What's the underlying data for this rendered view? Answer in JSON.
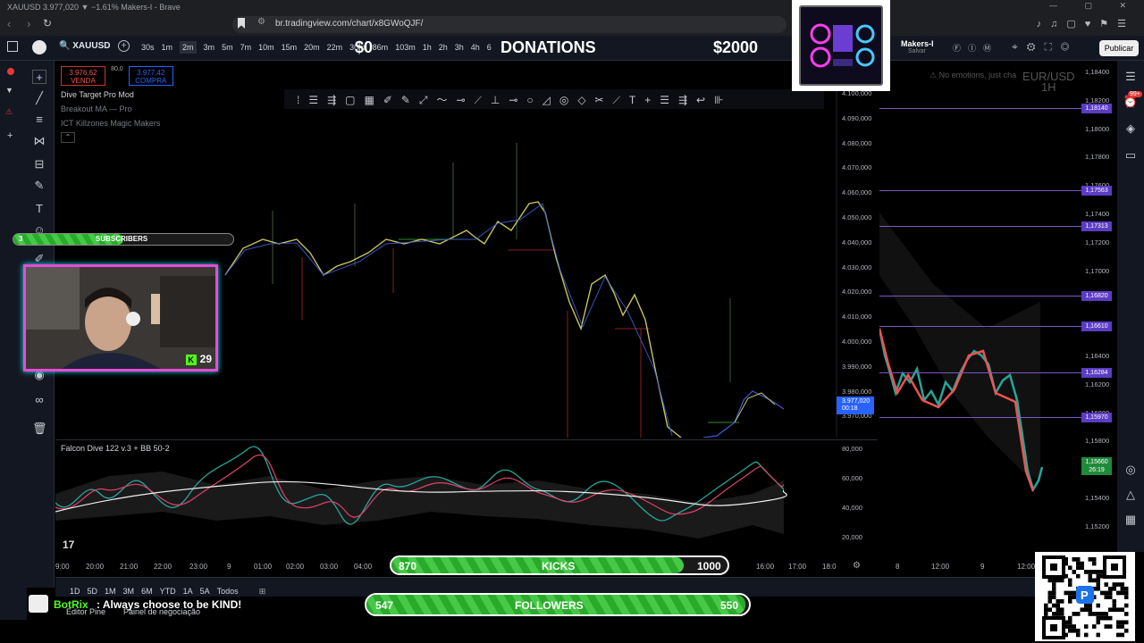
{
  "browser": {
    "window_title": "XAUUSD 3.977,020 ▼ −1.61% Makers-I - Brave",
    "url": "br.tradingview.com/chart/x8GWoQJF/"
  },
  "toolbar": {
    "symbol": "XAUUSD",
    "intervals": [
      "30s",
      "1m",
      "2m",
      "3m",
      "5m",
      "7m",
      "10m",
      "15m",
      "20m",
      "22m",
      "30m",
      "86m",
      "103m",
      "1h",
      "2h",
      "3h",
      "4h",
      "6"
    ],
    "active_interval": "2m",
    "layout_name": "Makers-I",
    "layout_sub": "Salvar",
    "publish_label": "Publicar"
  },
  "stream": {
    "donations_label": "DONATIONS",
    "donations_current": "$0",
    "donations_goal": "$2000",
    "subscribers": {
      "label": "SUBSCRIBERS",
      "current": "3",
      "goal": "6",
      "progress": 0.5
    },
    "kick_viewers": "29",
    "kicks": {
      "label": "KICKS",
      "current": "870",
      "goal": "1000",
      "progress": 0.87
    },
    "followers": {
      "label": "FOLLOWERS",
      "current": "547",
      "goal": "550",
      "progress": 0.99
    },
    "chat_user": "BotRix",
    "chat_message": ": Always choose to be KIND!"
  },
  "chart": {
    "sell_price": "3.976,62",
    "sell_label": "VENDA",
    "spread": "80,0",
    "buy_price": "3.977,42",
    "buy_label": "COMPRA",
    "indicators": [
      "Dive Target Pro Mod",
      "Breakout MA — Pro",
      "ICT Killzones Magic Makers"
    ],
    "oscillator_name": "Falcon Dive 122 v.3 + BB 50-2",
    "last_price": "3.977,020",
    "countdown": "00:18",
    "price_axis": [
      "4.100,000",
      "4.090,000",
      "4.080,000",
      "4.070,000",
      "4.060,000",
      "4.050,000",
      "4.040,000",
      "4.030,000",
      "4.020,000",
      "4.010,000",
      "4.000,000",
      "3.990,000",
      "3.980,000",
      "3.970,000"
    ],
    "osc_axis": [
      "80,000",
      "60,000",
      "40,000",
      "20,000"
    ],
    "time_axis": [
      "9:00",
      "20:00",
      "21:00",
      "22:00",
      "23:00",
      "9",
      "01:00",
      "02:00",
      "03:00",
      "04:00",
      "14:00",
      "16:00",
      "17:00",
      "18:0"
    ],
    "ranges": [
      "1D",
      "5D",
      "1M",
      "3M",
      "6M",
      "YTD",
      "1A",
      "5A",
      "Todos"
    ],
    "bottom_tabs": [
      "Editor Pine",
      "Painel de negociação"
    ]
  },
  "second_chart": {
    "symbol": "EUR/USD",
    "interval": "1H",
    "warning": "No emotions, just cha",
    "price_axis": [
      "1,18400",
      "1,18200",
      "1,18000",
      "1,17800",
      "1,17600",
      "1,17400",
      "1,17200",
      "1,17000",
      "1,16800",
      "1,16600",
      "1,16400",
      "1,16200",
      "1,16000",
      "1,15800",
      "1,15600",
      "1,15400",
      "1,15200"
    ],
    "levels": [
      "1,18140",
      "1,17563",
      "1,17313",
      "1,16820",
      "1,16610",
      "1,16284",
      "1,15970"
    ],
    "last_price": "1,15660",
    "countdown": "26:19",
    "time_axis": [
      "8",
      "12:00",
      "9",
      "12:00",
      "16"
    ]
  },
  "notifications": "99+"
}
